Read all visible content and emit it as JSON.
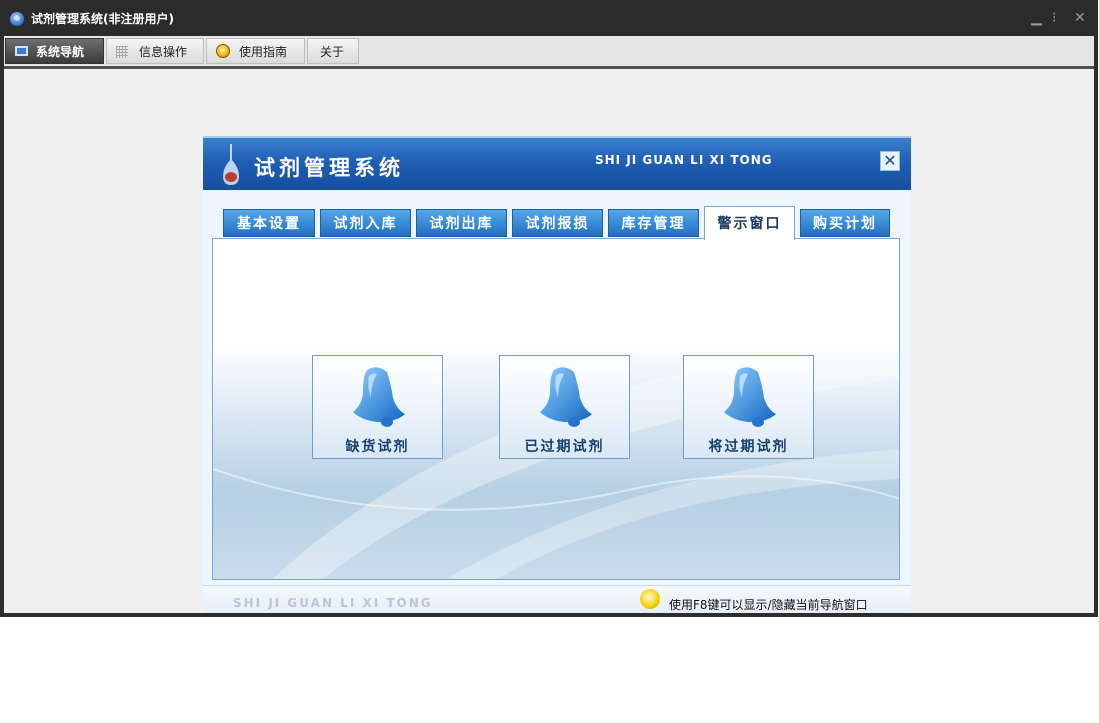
{
  "window": {
    "title": "试剂管理系统(非注册用户)",
    "controls": {
      "minimize": "▁",
      "restore": "⁝",
      "close": "✕"
    }
  },
  "toolbar": {
    "tabs": [
      {
        "label": "系统导航",
        "icon": "monitor-icon",
        "active": true
      },
      {
        "label": "信息操作",
        "icon": "grid-icon",
        "active": false
      },
      {
        "label": "使用指南",
        "icon": "bulb-icon",
        "active": false
      },
      {
        "label": "关于",
        "icon": "",
        "active": false
      }
    ]
  },
  "panel": {
    "title": "试剂管理系统",
    "subtitle": "SHI JI GUAN LI XI TONG",
    "close": "✕",
    "tabs": [
      {
        "label": "基本设置",
        "active": false
      },
      {
        "label": "试剂入库",
        "active": false
      },
      {
        "label": "试剂出库",
        "active": false
      },
      {
        "label": "试剂报损",
        "active": false
      },
      {
        "label": "库存管理",
        "active": false
      },
      {
        "label": "警示窗口",
        "active": true
      },
      {
        "label": "购买计划",
        "active": false
      }
    ],
    "alerts": [
      {
        "label": "缺货试剂",
        "icon": "bell-icon"
      },
      {
        "label": "已过期试剂",
        "icon": "bell-icon"
      },
      {
        "label": "将过期试剂",
        "icon": "bell-icon"
      }
    ],
    "footer": {
      "brand": "SHI JI GUAN LI XI TONG",
      "tip": "使用F8键可以显示/隐藏当前导航窗口"
    }
  },
  "colors": {
    "banner": "#1f5fb4",
    "tab": "#1e6fc2",
    "titlebar": "#2b2b2b"
  }
}
